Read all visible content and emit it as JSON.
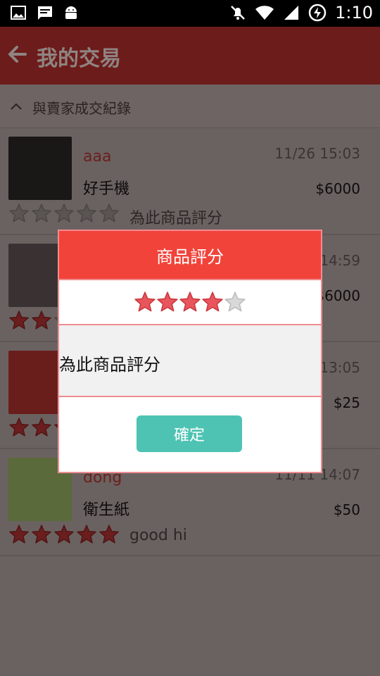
{
  "status_bar": {
    "time": "1:10",
    "left_icons": [
      "image-icon",
      "message-icon",
      "android-icon"
    ],
    "right_icons": [
      "mute-icon",
      "wifi-icon",
      "signal-icon",
      "battery-charging-icon"
    ]
  },
  "app_bar": {
    "title": "我的交易",
    "back_icon": "back-arrow-icon"
  },
  "section": {
    "label": "與賣家成交紀錄"
  },
  "transactions": [
    {
      "buyer": "aaa",
      "product": "好手機",
      "date": "11/26 15:03",
      "price": "$6000",
      "rating": 0,
      "comment": "為此商品評分",
      "thumb_color": "#1a1717"
    },
    {
      "buyer": "",
      "product": "",
      "date": "14:59",
      "price": "$6000",
      "rating": 2,
      "comment": "",
      "thumb_color": "#3a3232"
    },
    {
      "buyer": "",
      "product": "",
      "date": "13:05",
      "price": "$25",
      "rating": 3,
      "comment": "",
      "thumb_color": "#6a1e1c"
    },
    {
      "buyer": "dong",
      "product": "衛生紙",
      "date": "11/11 14:07",
      "price": "$50",
      "rating": 5,
      "comment": "good hi",
      "thumb_color": "#5a6a3a"
    }
  ],
  "dialog": {
    "title": "商品評分",
    "rating": 4,
    "max_rating": 5,
    "comment_text": "為此商品評分",
    "confirm_label": "確定"
  },
  "colors": {
    "dialog_header": "#f1433a",
    "confirm_button": "#4ec3b3",
    "dialog_border": "#ef8c92",
    "star_filled_dialog": "#e9555c",
    "star_empty_dialog": "#d8d8d8",
    "star_filled_dim": "#6b1e1e",
    "star_empty_dim": "#5a5453"
  }
}
